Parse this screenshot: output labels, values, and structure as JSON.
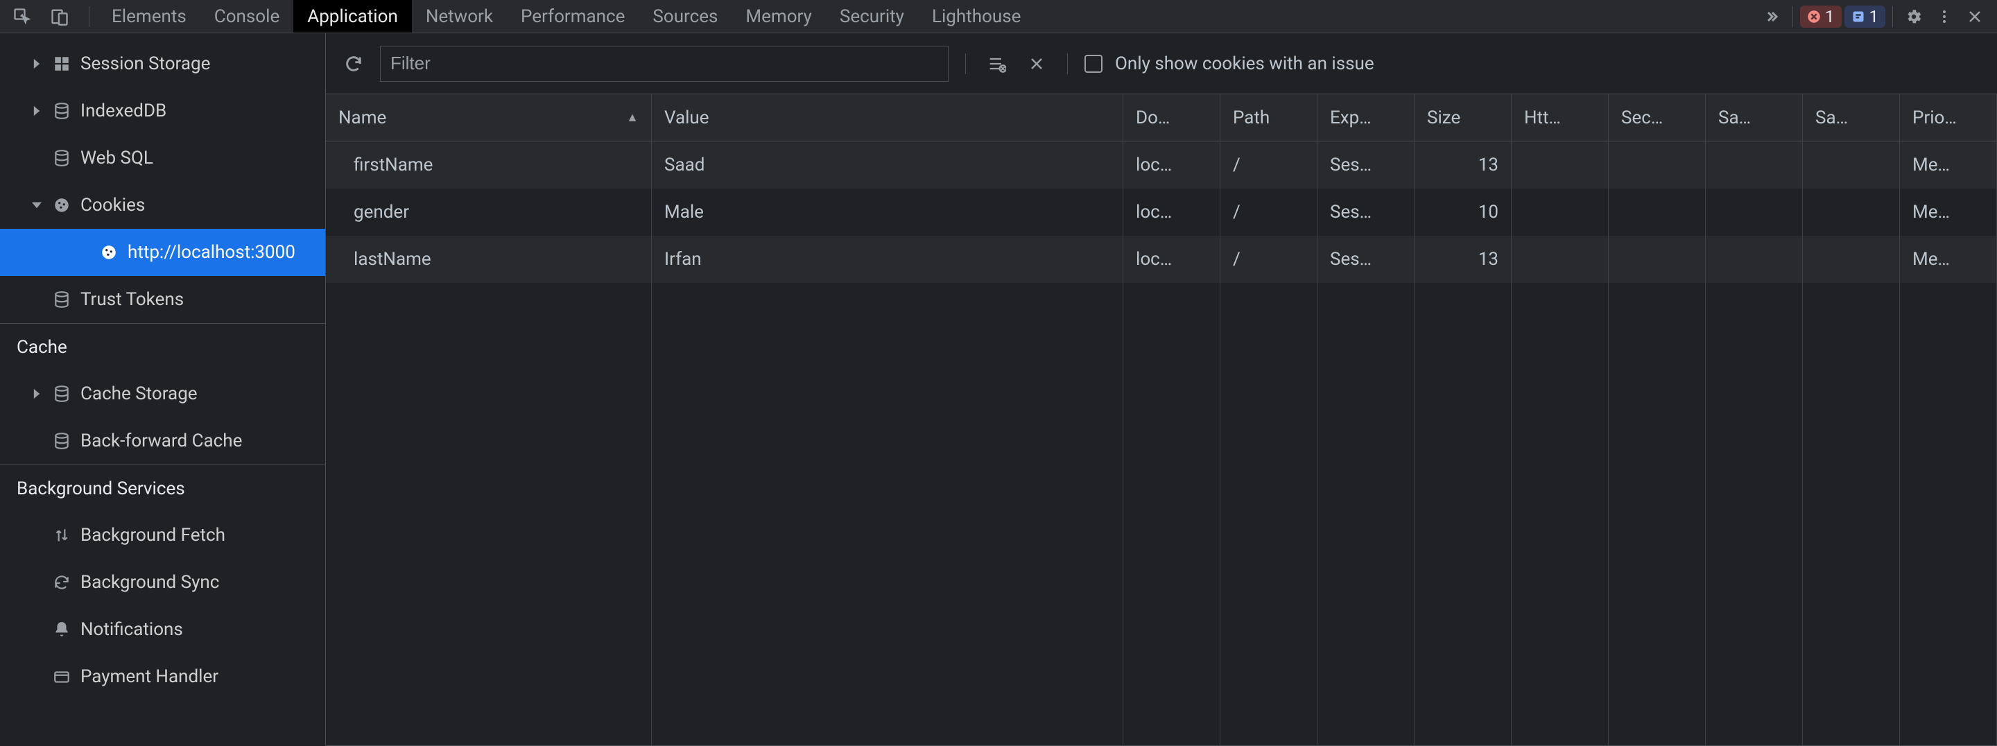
{
  "tabs": {
    "items": [
      "Elements",
      "Console",
      "Application",
      "Network",
      "Performance",
      "Sources",
      "Memory",
      "Security",
      "Lighthouse"
    ],
    "active_index": 2
  },
  "badges": {
    "errors": "1",
    "issues": "1"
  },
  "sidebar": {
    "storage_items": [
      {
        "label": "Session Storage",
        "icon": "grid",
        "arrow": "right",
        "depth": 1
      },
      {
        "label": "IndexedDB",
        "icon": "db",
        "arrow": "right",
        "depth": 1
      },
      {
        "label": "Web SQL",
        "icon": "db",
        "arrow": "",
        "depth": 1
      },
      {
        "label": "Cookies",
        "icon": "cookie",
        "arrow": "down",
        "depth": 1
      },
      {
        "label": "http://localhost:3000",
        "icon": "cookie",
        "arrow": "",
        "depth": 2,
        "selected": true
      },
      {
        "label": "Trust Tokens",
        "icon": "db",
        "arrow": "",
        "depth": 1
      }
    ],
    "cache_header": "Cache",
    "cache_items": [
      {
        "label": "Cache Storage",
        "icon": "db",
        "arrow": "right",
        "depth": 1
      },
      {
        "label": "Back-forward Cache",
        "icon": "db",
        "arrow": "",
        "depth": 1
      }
    ],
    "bg_header": "Background Services",
    "bg_items": [
      {
        "label": "Background Fetch",
        "icon": "updown",
        "depth": 1
      },
      {
        "label": "Background Sync",
        "icon": "sync",
        "depth": 1
      },
      {
        "label": "Notifications",
        "icon": "bell",
        "depth": 1
      },
      {
        "label": "Payment Handler",
        "icon": "card",
        "depth": 1
      }
    ]
  },
  "toolbar": {
    "filter_placeholder": "Filter",
    "only_issues_label": "Only show cookies with an issue"
  },
  "table": {
    "columns": [
      "Name",
      "Value",
      "Do…",
      "Path",
      "Exp…",
      "Size",
      "Htt…",
      "Sec…",
      "Sa…",
      "Sa…",
      "Prio…"
    ],
    "sort_col_index": 0,
    "rows": [
      {
        "name": "firstName",
        "value": "Saad",
        "domain": "loc…",
        "path": "/",
        "expires": "Ses…",
        "size": "13",
        "http": "",
        "secure": "",
        "samesite1": "",
        "samesite2": "",
        "priority": "Me…"
      },
      {
        "name": "gender",
        "value": "Male",
        "domain": "loc…",
        "path": "/",
        "expires": "Ses…",
        "size": "10",
        "http": "",
        "secure": "",
        "samesite1": "",
        "samesite2": "",
        "priority": "Me…"
      },
      {
        "name": "lastName",
        "value": "Irfan",
        "domain": "loc…",
        "path": "/",
        "expires": "Ses…",
        "size": "13",
        "http": "",
        "secure": "",
        "samesite1": "",
        "samesite2": "",
        "priority": "Me…"
      }
    ]
  }
}
